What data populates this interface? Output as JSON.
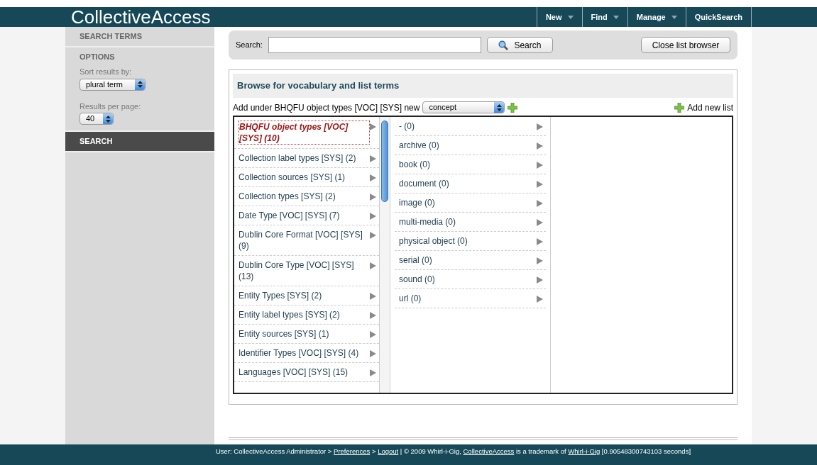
{
  "header": {
    "logo": "CollectiveAccess",
    "nav": [
      {
        "label": "New",
        "dropdown": true
      },
      {
        "label": "Find",
        "dropdown": true
      },
      {
        "label": "Manage",
        "dropdown": true
      },
      {
        "label": "QuickSearch",
        "dropdown": false
      }
    ]
  },
  "sidebar": {
    "sections": [
      {
        "title": "SEARCH TERMS",
        "selected": false
      },
      {
        "title": "OPTIONS",
        "selected": false,
        "fields": [
          {
            "label": "Sort results by:",
            "value": "plural term"
          },
          {
            "label": "Results per page:",
            "value": "40"
          }
        ]
      },
      {
        "title": "SEARCH",
        "selected": true
      }
    ]
  },
  "search_bar": {
    "label": "Search:",
    "button": "Search",
    "close_button": "Close list browser"
  },
  "browser": {
    "title": "Browse for vocabulary and list terms",
    "add_prefix": "Add under BHQFU object types [VOC] [SYS] new",
    "type_value": "concept",
    "add_list": "Add new list",
    "column_1": [
      {
        "label": "BHQFU object types [VOC] [SYS] (10)",
        "selected": true
      },
      {
        "label": "Collection label types [SYS] (2)",
        "selected": false
      },
      {
        "label": "Collection sources [SYS] (1)",
        "selected": false
      },
      {
        "label": "Collection types [SYS] (2)",
        "selected": false
      },
      {
        "label": "Date Type [VOC] [SYS] (7)",
        "selected": false
      },
      {
        "label": "Dublin Core Format [VOC] [SYS] (9)",
        "selected": false
      },
      {
        "label": "Dublin Core Type [VOC] [SYS] (13)",
        "selected": false
      },
      {
        "label": "Entity Types [SYS] (2)",
        "selected": false
      },
      {
        "label": "Entity label types [SYS] (2)",
        "selected": false
      },
      {
        "label": "Entity sources [SYS] (1)",
        "selected": false
      },
      {
        "label": "Identifier Types [VOC] [SYS] (4)",
        "selected": false
      },
      {
        "label": "Languages [VOC] [SYS] (15)",
        "selected": false
      }
    ],
    "column_2": [
      {
        "label": "- (0)",
        "selected": false
      },
      {
        "label": "archive (0)",
        "selected": false
      },
      {
        "label": "book (0)",
        "selected": false
      },
      {
        "label": "document (0)",
        "selected": false
      },
      {
        "label": "image (0)",
        "selected": false
      },
      {
        "label": "multi-media (0)",
        "selected": false
      },
      {
        "label": "physical object (0)",
        "selected": false
      },
      {
        "label": "serial (0)",
        "selected": false
      },
      {
        "label": "sound (0)",
        "selected": false
      },
      {
        "label": "url (0)",
        "selected": false
      }
    ]
  },
  "footer": [
    {
      "kind": "text",
      "text": "User: CollectiveAccess Administrator >"
    },
    {
      "kind": "link",
      "text": "Preferences"
    },
    {
      "kind": "text",
      "text": ">"
    },
    {
      "kind": "link",
      "text": "Logout"
    },
    {
      "kind": "text",
      "text": "|  © 2009 Whirl-i-Gig,"
    },
    {
      "kind": "link",
      "text": "CollectiveAccess"
    },
    {
      "kind": "text",
      "text": "is a trademark of"
    },
    {
      "kind": "link",
      "text": "Whirl-i-Gig"
    },
    {
      "kind": "text",
      "text": "[0.90548300743103 seconds]"
    }
  ]
}
